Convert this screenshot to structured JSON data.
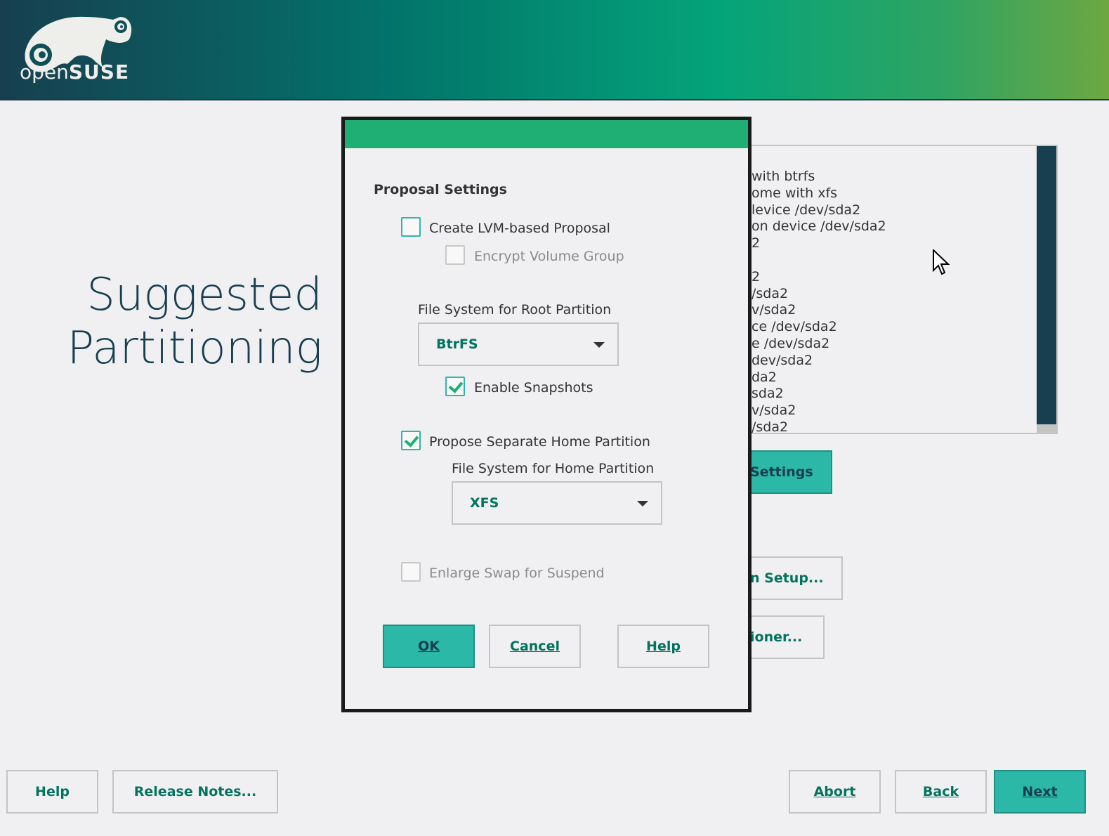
{
  "header": {
    "logo_text_light": "open",
    "logo_text_bold": "SUSE"
  },
  "page": {
    "title_line1": "Suggested",
    "title_line2": "Partitioning"
  },
  "background_list": {
    "lines": [
      "with btrfs",
      "ome with xfs",
      "levice /dev/sda2",
      "on device /dev/sda2",
      "2",
      "",
      "2",
      "/sda2",
      "v/sda2",
      "ce /dev/sda2",
      "e /dev/sda2",
      "dev/sda2",
      "da2",
      "sda2",
      "v/sda2",
      "/sda2"
    ]
  },
  "background_buttons": {
    "settings": "Settings",
    "setup": "n Setup...",
    "partitioner": "ioner..."
  },
  "dialog": {
    "heading": "Proposal Settings",
    "lvm_label": "Create LVM-based Proposal",
    "lvm_checked": false,
    "encrypt_label": "Encrypt Volume Group",
    "encrypt_checked": false,
    "root_fs_label": "File System for Root Partition",
    "root_fs_value": "BtrFS",
    "snapshots_label": "Enable Snapshots",
    "snapshots_checked": true,
    "home_label": "Propose Separate Home Partition",
    "home_checked": true,
    "home_fs_label": "File System for Home Partition",
    "home_fs_value": "XFS",
    "swap_label": "Enlarge Swap for Suspend",
    "swap_checked": false,
    "ok": "OK",
    "cancel": "Cancel",
    "help": "Help"
  },
  "footer": {
    "help": "Help",
    "release_notes": "Release Notes...",
    "abort": "Abort",
    "back": "Back",
    "next": "Next"
  },
  "colors": {
    "accent": "#2cb8a6",
    "title_bar": "#1fae74",
    "dark": "#173f4f"
  }
}
